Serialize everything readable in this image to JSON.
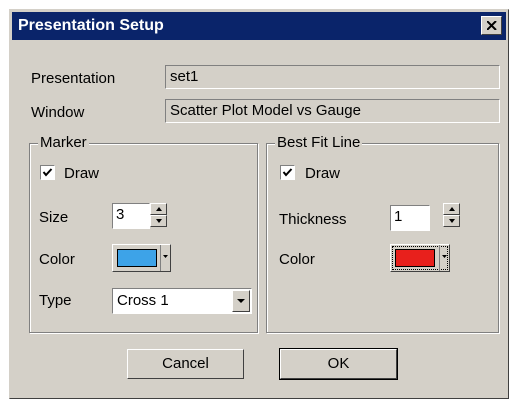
{
  "window": {
    "title": "Presentation Setup"
  },
  "fields": {
    "presentation_label": "Presentation",
    "presentation_value": "set1",
    "window_label": "Window",
    "window_value": "Scatter Plot Model vs Gauge"
  },
  "marker": {
    "legend": "Marker",
    "draw_label": "Draw",
    "draw_checked": true,
    "size_label": "Size",
    "size_value": "3",
    "color_label": "Color",
    "color": "#3da3e8",
    "type_label": "Type",
    "type_value": "Cross 1"
  },
  "best_fit": {
    "legend": "Best Fit Line",
    "draw_label": "Draw",
    "draw_checked": true,
    "thickness_label": "Thickness",
    "thickness_value": "1",
    "color_label": "Color",
    "color": "#e8201c"
  },
  "buttons": {
    "cancel": "Cancel",
    "ok": "OK"
  },
  "icons": {
    "close": "close-icon",
    "check": "checkmark-icon",
    "spin_up": "arrow-up-icon",
    "spin_down": "arrow-down-icon",
    "dropdown": "chevron-down-icon"
  }
}
